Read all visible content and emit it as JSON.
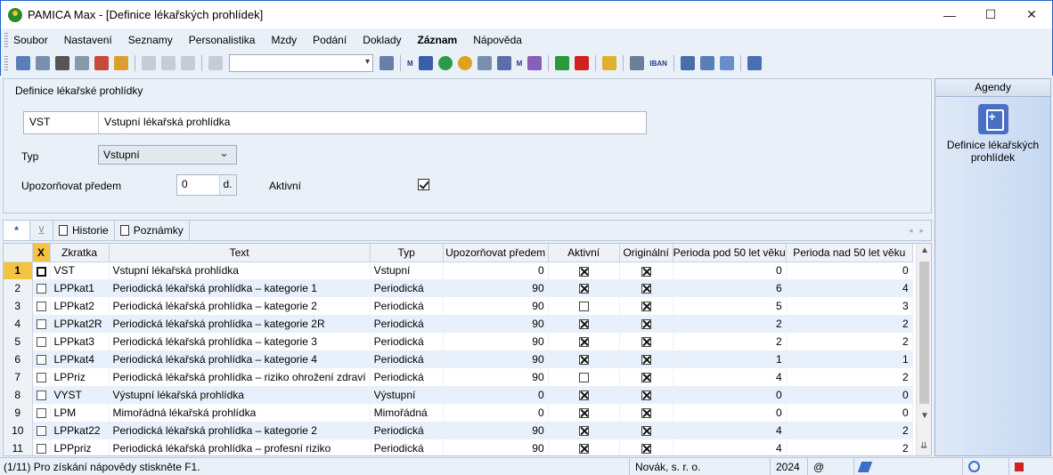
{
  "window": {
    "title": "PAMICA Max - [Definice lékařských prohlídek]",
    "minimize": "—",
    "maximize": "☐",
    "close": "✕"
  },
  "menu": [
    "Soubor",
    "Nastavení",
    "Seznamy",
    "Personalistika",
    "Mzdy",
    "Podání",
    "Doklady",
    "Záznam",
    "Nápověda"
  ],
  "toolbar": {
    "combo_value": "",
    "iban_label": "IBAN",
    "m_label": "M"
  },
  "form": {
    "title": "Definice lékařské prohlídky",
    "code": "VST",
    "name": "Vstupní lékařská prohlídka",
    "type_label": "Typ",
    "type_value": "Vstupní",
    "notify_label": "Upozorňovat předem",
    "notify_value": "0",
    "notify_unit": "d.",
    "active_label": "Aktivní",
    "active_checked": true
  },
  "side_panel": {
    "header": "Agendy",
    "item_label": "Definice lékařských prohlídek"
  },
  "tabs": {
    "star": "*",
    "filter": "⊻",
    "history": "Historie",
    "notes": "Poznámky",
    "prev": "◂",
    "next": "▸"
  },
  "grid": {
    "columns": {
      "x": "X",
      "code": "Zkratka",
      "text": "Text",
      "type": "Typ",
      "notify": "Upozorňovat předem",
      "active": "Aktivní",
      "original": "Originální",
      "period_under": "Perioda pod 50 let věku",
      "period_over": "Perioda nad 50 let věku"
    },
    "rows": [
      {
        "n": "1",
        "code": "VST",
        "text": "Vstupní lékařská prohlídka",
        "type": "Vstupní",
        "notify": "0",
        "active": true,
        "original": true,
        "under": "0",
        "over": "0"
      },
      {
        "n": "2",
        "code": "LPPkat1",
        "text": "Periodická lékařská prohlídka – kategorie 1",
        "type": "Periodická",
        "notify": "90",
        "active": true,
        "original": true,
        "under": "6",
        "over": "4"
      },
      {
        "n": "3",
        "code": "LPPkat2",
        "text": "Periodická lékařská prohlídka – kategorie 2",
        "type": "Periodická",
        "notify": "90",
        "active": false,
        "original": true,
        "under": "5",
        "over": "3"
      },
      {
        "n": "4",
        "code": "LPPkat2R",
        "text": "Periodická lékařská prohlídka – kategorie 2R",
        "type": "Periodická",
        "notify": "90",
        "active": true,
        "original": true,
        "under": "2",
        "over": "2"
      },
      {
        "n": "5",
        "code": "LPPkat3",
        "text": "Periodická lékařská prohlídka – kategorie 3",
        "type": "Periodická",
        "notify": "90",
        "active": true,
        "original": true,
        "under": "2",
        "over": "2"
      },
      {
        "n": "6",
        "code": "LPPkat4",
        "text": "Periodická lékařská prohlídka – kategorie 4",
        "type": "Periodická",
        "notify": "90",
        "active": true,
        "original": true,
        "under": "1",
        "over": "1"
      },
      {
        "n": "7",
        "code": "LPPriz",
        "text": "Periodická lékařská prohlídka – riziko ohrožení zdraví",
        "type": "Periodická",
        "notify": "90",
        "active": false,
        "original": true,
        "under": "4",
        "over": "2"
      },
      {
        "n": "8",
        "code": "VYST",
        "text": "Výstupní lékařská prohlídka",
        "type": "Výstupní",
        "notify": "0",
        "active": true,
        "original": true,
        "under": "0",
        "over": "0"
      },
      {
        "n": "9",
        "code": "LPM",
        "text": "Mimořádná lékařská prohlídka",
        "type": "Mimořádná",
        "notify": "0",
        "active": true,
        "original": true,
        "under": "0",
        "over": "0"
      },
      {
        "n": "10",
        "code": "LPPkat22",
        "text": "Periodická lékařská prohlídka – kategorie 2",
        "type": "Periodická",
        "notify": "90",
        "active": true,
        "original": true,
        "under": "4",
        "over": "2"
      },
      {
        "n": "11",
        "code": "LPPpriz",
        "text": "Periodická lékařská prohlídka – profesní riziko",
        "type": "Periodická",
        "notify": "90",
        "active": true,
        "original": true,
        "under": "4",
        "over": "2"
      }
    ]
  },
  "status": {
    "help": "(1/11) Pro získání nápovědy stiskněte F1.",
    "company": "Novák, s. r. o.",
    "year": "2024",
    "at": "@"
  },
  "colors": {
    "accent": "#1e66c8",
    "selection": "#f5c342",
    "row_alt": "#e8f0fb"
  }
}
